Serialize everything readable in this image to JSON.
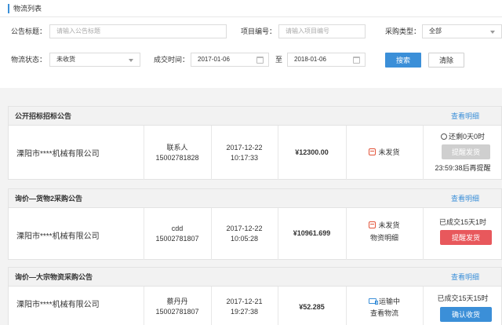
{
  "breadcrumb": "物流列表",
  "filters": {
    "title_label": "公告标题：",
    "title_placeholder": "请输入公告标题",
    "project_label": "项目编号：",
    "project_placeholder": "请输入项目编号",
    "purchase_type_label": "采购类型：",
    "purchase_type_value": "全部",
    "status_label": "物流状态：",
    "status_value": "未收货",
    "date_label": "成交时间：",
    "date_from": "2017-01-06",
    "date_sep": "至",
    "date_to": "2018-01-06",
    "search_label": "搜索",
    "clear_label": "清除"
  },
  "cards": [
    {
      "title": "公开招标招标公告",
      "link": "查看明细",
      "company": "溧阳市****机械有限公司",
      "contact_name": "联系人",
      "contact_phone": "15002781828",
      "date": "2017-12-22",
      "time": "10:17:33",
      "amount": "¥12300.00",
      "status": "未发货",
      "status_sub": "",
      "action_top": "还剩0天0时",
      "action_button": "提醒发货",
      "action_bottom": "23:59:38后再提醒"
    },
    {
      "title": "询价—货物2采购公告",
      "link": "查看明细",
      "company": "溧阳市****机械有限公司",
      "contact_name": "cdd",
      "contact_phone": "15002781807",
      "date": "2017-12-22",
      "time": "10:05:28",
      "amount": "¥10961.699",
      "status": "未发货",
      "status_sub": "物资明细",
      "action_top": "已成交15天1时",
      "action_button": "提醒发货",
      "action_bottom": ""
    },
    {
      "title": "询价—大宗物资采购公告",
      "link": "查看明细",
      "company": "溧阳市****机械有限公司",
      "contact_name": "蔡丹丹",
      "contact_phone": "15002781807",
      "date": "2017-12-21",
      "time": "19:27:38",
      "amount": "¥52.285",
      "status": "运输中",
      "status_sub": "查看物流",
      "action_top": "已成交15天15时",
      "action_button": "确认收货",
      "action_bottom": ""
    }
  ]
}
